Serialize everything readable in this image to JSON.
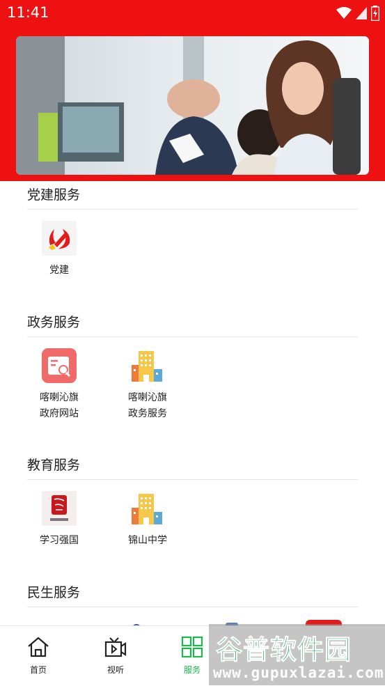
{
  "status_bar": {
    "time": "11:41"
  },
  "sections": [
    {
      "title": "党建服务",
      "items": [
        {
          "label": "党建",
          "icon": "party-emblem-icon"
        }
      ]
    },
    {
      "title": "政务服务",
      "items": [
        {
          "label": "喀喇沁旗\n政府网站",
          "icon": "web-document-icon"
        },
        {
          "label": "喀喇沁旗\n政务服务",
          "icon": "buildings-icon"
        }
      ]
    },
    {
      "title": "教育服务",
      "items": [
        {
          "label": "学习强国",
          "icon": "xuexi-qiangguo-icon"
        },
        {
          "label": "锦山中学",
          "icon": "buildings-icon"
        }
      ]
    },
    {
      "title": "民生服务",
      "items": []
    }
  ],
  "bottom_nav": [
    {
      "label": "首页",
      "icon": "home-icon"
    },
    {
      "label": "视听",
      "icon": "tv-icon"
    },
    {
      "label": "服务",
      "icon": "grid-icon",
      "active": true
    }
  ],
  "watermark": {
    "title": "谷普软件园",
    "url": "www.gupuxlazai.com"
  },
  "colors": {
    "brand_red": "#ee1111",
    "active_green": "#19b84a",
    "building_yellow": "#f7c74a"
  }
}
